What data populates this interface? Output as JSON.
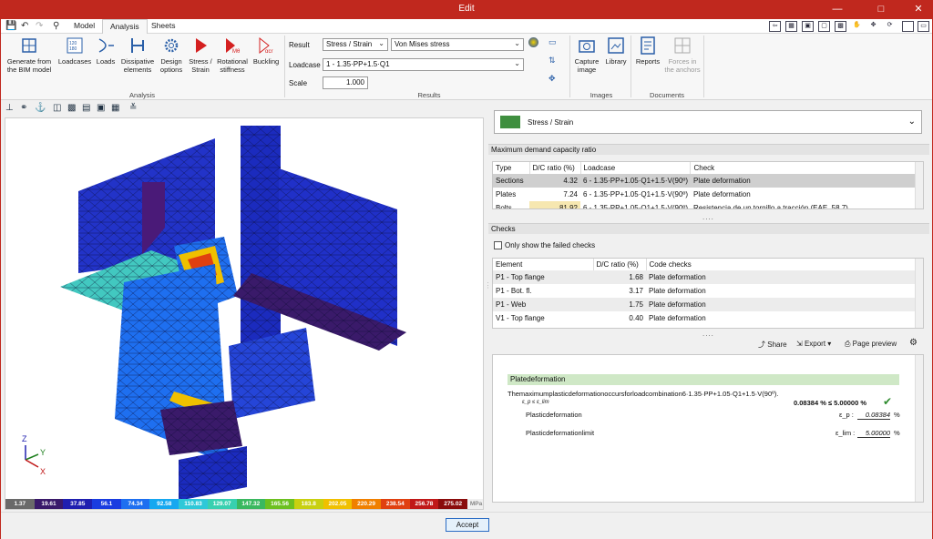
{
  "window": {
    "title": "Edit"
  },
  "ribbon_tabs": [
    "Model",
    "Analysis",
    "Sheets"
  ],
  "analysis_group": {
    "label": "Analysis",
    "buttons": [
      "Generate from the BIM model",
      "Loadcases",
      "Loads",
      "Dissipative elements",
      "Design options",
      "Stress / Strain",
      "Rotational stiffness",
      "Buckling"
    ]
  },
  "results_group": {
    "label": "Results",
    "result_label": "Result",
    "result_type": "Stress / Strain",
    "result_value": "Von Mises stress",
    "loadcase_label": "Loadcase",
    "loadcase_value": "1 - 1.35·PP+1.5·Q1",
    "scale_label": "Scale",
    "scale_value": "1.000"
  },
  "images_group": {
    "label": "Images",
    "buttons": [
      "Capture image",
      "Library"
    ]
  },
  "documents_group": {
    "label": "Documents",
    "buttons": [
      "Reports",
      "Forces in the anchors"
    ]
  },
  "legend": {
    "values": [
      "1.37",
      "19.61",
      "37.85",
      "56.1",
      "74.34",
      "92.58",
      "110.83",
      "129.07",
      "147.32",
      "165.56",
      "183.8",
      "202.05",
      "220.29",
      "238.54",
      "256.78",
      "275.02"
    ],
    "unit": "MPa",
    "colors": [
      "#6a6a6a",
      "#3a1a6a",
      "#1f1fb0",
      "#1a3ce0",
      "#1e6ff0",
      "#16a8f0",
      "#2ec8d8",
      "#38d0b0",
      "#3ab860",
      "#6cc020",
      "#c8d010",
      "#f0c000",
      "#f08000",
      "#e04010",
      "#c01818",
      "#8a0c0c"
    ]
  },
  "axes": {
    "z": "Z",
    "y": "Y",
    "x": "X"
  },
  "right_panel": {
    "result_selector": "Stress / Strain",
    "max_dc": {
      "title": "Maximum demand capacity ratio",
      "columns": [
        "Type",
        "D/C ratio (%)",
        "Loadcase",
        "Check"
      ],
      "rows": [
        [
          "Sections",
          "4.32",
          "6 - 1.35·PP+1.05·Q1+1.5·V(90º)",
          "Plate deformation"
        ],
        [
          "Plates",
          "7.24",
          "6 - 1.35·PP+1.05·Q1+1.5·V(90º)",
          "Plate deformation"
        ],
        [
          "Bolts",
          "81.92",
          "6 - 1.35·PP+1.05·Q1+1.5·V(90º)",
          "Resistencia de un tornillo a tracción (EAE, 58.7)"
        ]
      ]
    },
    "checks": {
      "title": "Checks",
      "failed_only_label": "Only show the failed checks",
      "columns": [
        "Element",
        "D/C ratio (%)",
        "Code checks"
      ],
      "rows": [
        [
          "P1 - Top flange",
          "1.68",
          "Plate deformation"
        ],
        [
          "P1 - Bot. fl.",
          "3.17",
          "Plate deformation"
        ],
        [
          "P1 - Web",
          "1.75",
          "Plate deformation"
        ],
        [
          "V1 - Top flange",
          "0.40",
          "Plate deformation"
        ]
      ]
    },
    "actions": {
      "share": "Share",
      "export": "Export",
      "preview": "Page preview"
    },
    "report": {
      "heading": "Platedeformation",
      "sentence": "Themaximumplasticdeformationoccursforloadcombination6·1.35·PP+1.05·Q1+1.5·V(90º).",
      "condition": "ε_p ≤ ε_lim",
      "result": "0.08384 % ≤ 5.00000 %",
      "line1_label": "Plasticdeformation",
      "line1_sym": "ε_p :",
      "line1_val": "0.08384",
      "line2_label": "Plasticdeformationlimit",
      "line2_sym": "ε_lim :",
      "line2_val": "5.00000",
      "unit": "%"
    }
  },
  "accept_label": "Accept"
}
